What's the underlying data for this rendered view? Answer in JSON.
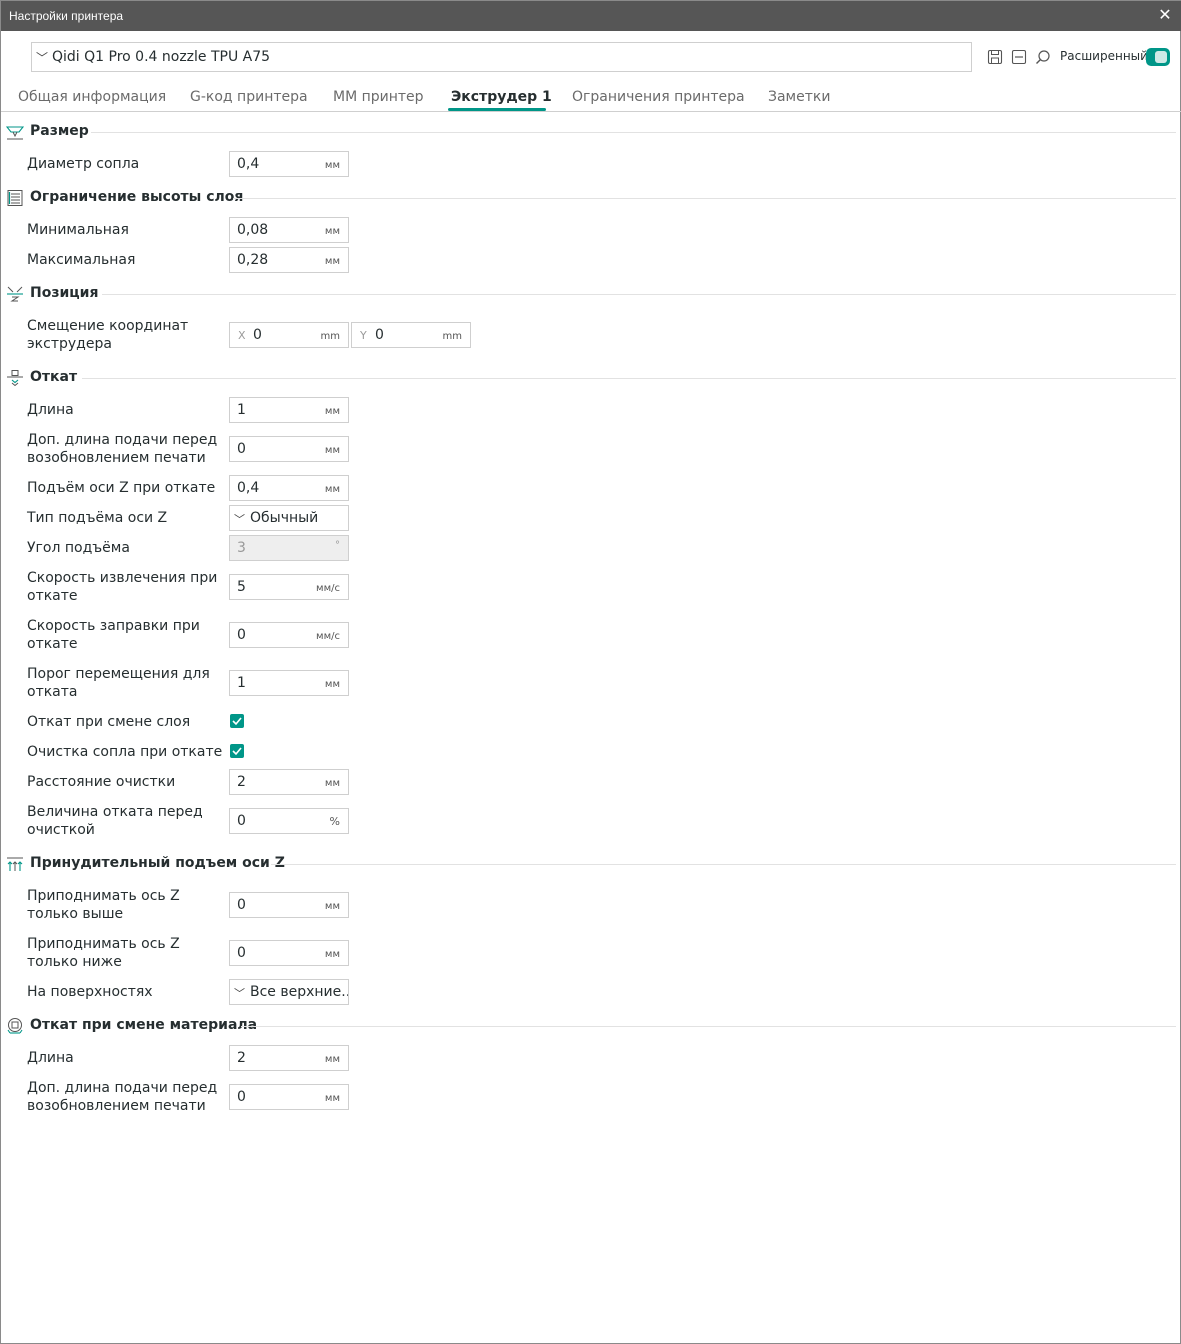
{
  "window": {
    "title": "Настройки принтера",
    "close_icon": "close-icon"
  },
  "toolbar": {
    "preset": "Qidi Q1 Pro 0.4 nozzle TPU A75",
    "advanced_label": "Расширенный",
    "advanced_on": true,
    "accent": "#009688"
  },
  "tabs": [
    {
      "label": "Общая информация"
    },
    {
      "label": "G-код принтера"
    },
    {
      "label": "ММ принтер"
    },
    {
      "label": "Экструдер 1",
      "active": true
    },
    {
      "label": "Ограничения принтера"
    },
    {
      "label": "Заметки"
    }
  ],
  "sections": {
    "size": {
      "title": "Размер",
      "nozzle_diameter": {
        "label": "Диаметр сопла",
        "value": "0,4",
        "unit": "мм"
      }
    },
    "layer_height": {
      "title": "Ограничение высоты слоя",
      "min": {
        "label": "Минимальная",
        "value": "0,08",
        "unit": "мм"
      },
      "max": {
        "label": "Максимальная",
        "value": "0,28",
        "unit": "мм"
      }
    },
    "position": {
      "title": "Позиция",
      "offset": {
        "label": "Смещение координат экструдера",
        "x_axis": "X",
        "x_value": "0",
        "y_axis": "Y",
        "y_value": "0",
        "unit": "mm"
      }
    },
    "retraction": {
      "title": "Откат",
      "length": {
        "label": "Длина",
        "value": "1",
        "unit": "мм"
      },
      "extra_length": {
        "label": "Доп. длина подачи перед возобновлением печати",
        "value": "0",
        "unit": "мм"
      },
      "z_hop": {
        "label": "Подъём оси Z при откате",
        "value": "0,4",
        "unit": "мм"
      },
      "z_hop_type": {
        "label": "Тип подъёма оси Z",
        "value": "Обычный"
      },
      "lift_angle": {
        "label": "Угол подъёма",
        "value": "3",
        "unit": "°"
      },
      "retract_speed": {
        "label": "Скорость извлечения при откате",
        "value": "5",
        "unit": "мм/с"
      },
      "deretract_speed": {
        "label": "Скорость заправки при откате",
        "value": "0",
        "unit": "мм/с"
      },
      "travel_threshold": {
        "label": "Порог перемещения для отката",
        "value": "1",
        "unit": "мм"
      },
      "retract_layer_change": {
        "label": "Откат при смене слоя",
        "checked": true
      },
      "wipe": {
        "label": "Очистка сопла при откате",
        "checked": true
      },
      "wipe_distance": {
        "label": "Расстояние очистки",
        "value": "2",
        "unit": "мм"
      },
      "retract_before_wipe": {
        "label": "Величина отката перед очисткой",
        "value": "0",
        "unit": "%"
      }
    },
    "z_lift": {
      "title": "Принудительный подъем оси Z",
      "above": {
        "label": "Приподнимать ось Z только выше",
        "value": "0",
        "unit": "мм"
      },
      "below": {
        "label": "Приподнимать ось Z только ниже",
        "value": "0",
        "unit": "мм"
      },
      "surfaces": {
        "label": "На поверхностях",
        "value": "Все верхние..."
      }
    },
    "material_change": {
      "title": "Откат при смене материала",
      "length": {
        "label": "Длина",
        "value": "2",
        "unit": "мм"
      },
      "extra_length": {
        "label": "Доп. длина подачи перед возобновлением печати",
        "value": "0",
        "unit": "мм"
      }
    }
  }
}
